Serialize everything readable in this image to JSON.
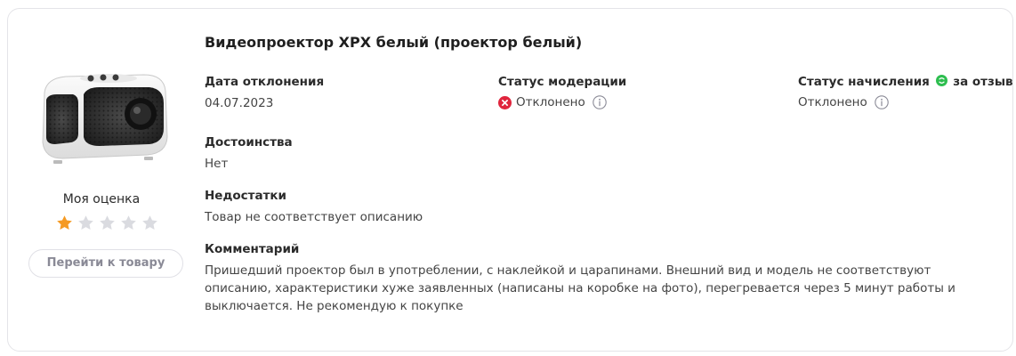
{
  "product": {
    "title": "Видеопроектор XPX белый (проектор белый)",
    "image_icon": "projector-image"
  },
  "rating": {
    "label": "Моя оценка",
    "value": 1,
    "max": 5,
    "filled_color": "#f59a23",
    "empty_color": "#dadbe0"
  },
  "go_button": {
    "label": "Перейти к товару"
  },
  "rejection_date": {
    "label": "Дата отклонения",
    "value": "04.07.2023"
  },
  "moderation_status": {
    "label": "Статус модерации",
    "value": "Отклонено",
    "icon": "error-circle-icon",
    "icon_color": "#e0253d"
  },
  "accrual_status": {
    "label_before": "Статус начисления",
    "label_after": "за отзыв",
    "value": "Отклонено",
    "coin_color": "#2dbe4f"
  },
  "advantages": {
    "label": "Достоинства",
    "value": "Нет"
  },
  "disadvantages": {
    "label": "Недостатки",
    "value": "Товар не соответствует описанию"
  },
  "comment": {
    "label": "Комментарий",
    "value": "Пришедший проектор был в употреблении, с наклейкой и царапинами. Внешний вид и модель не соответствуют описанию, характеристики хуже заявленных (написаны на коробке на фото), перегревается через 5 минут работы и выключается. Не рекомендую к покупке"
  }
}
